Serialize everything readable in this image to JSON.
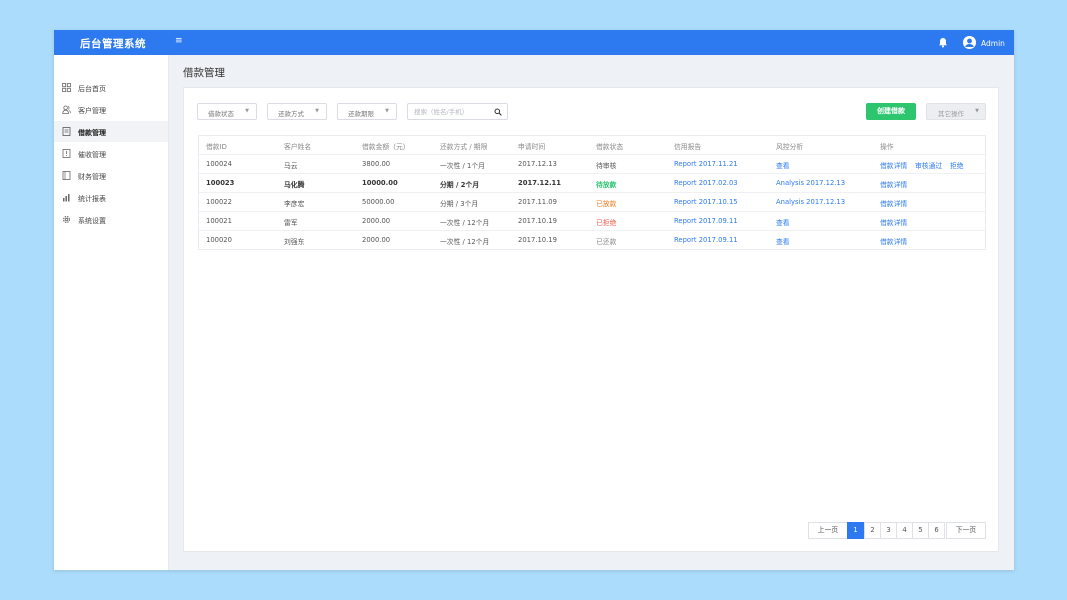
{
  "header": {
    "app_title": "后台管理系统",
    "menu_icon": "menu-icon",
    "bell_icon": "bell-icon",
    "user_name": "Admin",
    "accent_color": "#2d7af0"
  },
  "sidebar": {
    "items": [
      {
        "label": "后台首页",
        "icon": "grid-icon",
        "active": false
      },
      {
        "label": "客户管理",
        "icon": "users-icon",
        "active": false
      },
      {
        "label": "借款管理",
        "icon": "document-icon",
        "active": true
      },
      {
        "label": "催收管理",
        "icon": "flag-icon",
        "active": false
      },
      {
        "label": "财务管理",
        "icon": "book-icon",
        "active": false
      },
      {
        "label": "统计报表",
        "icon": "bar-chart-icon",
        "active": false
      },
      {
        "label": "系统设置",
        "icon": "gear-icon",
        "active": false
      }
    ]
  },
  "page": {
    "title": "借款管理"
  },
  "filters": {
    "status": "借款状态",
    "method": "还款方式",
    "term": "还款期限",
    "search_placeholder": "搜索（姓名/手机）"
  },
  "actions": {
    "create": "创建借款",
    "other": "其它操作",
    "create_color": "#2ec56f"
  },
  "table": {
    "columns": [
      "借款ID",
      "客户姓名",
      "借款金额（元）",
      "还款方式 / 期限",
      "申请时间",
      "借款状态",
      "信用报告",
      "风控分析",
      "操作"
    ],
    "rows": [
      {
        "id": "100024",
        "name": "马云",
        "amount": "3800.00",
        "method": "一次性 / 1个月",
        "date": "2017.12.13",
        "status": "待审核",
        "report": "Report  2017.11.21",
        "risk": "查看",
        "op1": "借款详情",
        "op2": "审核通过",
        "op3": "拒绝"
      },
      {
        "id": "100023",
        "name": "马化腾",
        "amount": "10000.00",
        "method": "分期 / 2个月",
        "date": "2017.12.11",
        "status": "待放款",
        "report": "Report  2017.02.03",
        "risk": "Analysis   2017.12.13",
        "op1": "借款详情",
        "op2": "",
        "op3": ""
      },
      {
        "id": "100022",
        "name": "李彦宏",
        "amount": "50000.00",
        "method": "分期 / 3个月",
        "date": "2017.11.09",
        "status": "已放款",
        "report": "Report  2017.10.15",
        "risk": "Analysis   2017.12.13",
        "op1": "借款详情",
        "op2": "",
        "op3": ""
      },
      {
        "id": "100021",
        "name": "雷军",
        "amount": "2000.00",
        "method": "一次性 / 12个月",
        "date": "2017.10.19",
        "status": "已拒绝",
        "report": "Report  2017.09.11",
        "risk": "查看",
        "op1": "借款详情",
        "op2": "",
        "op3": ""
      },
      {
        "id": "100020",
        "name": "刘强东",
        "amount": "2000.00",
        "method": "一次性 / 12个月",
        "date": "2017.10.19",
        "status": "已还款",
        "report": "Report  2017.09.11",
        "risk": "查看",
        "op1": "借款详情",
        "op2": "",
        "op3": ""
      }
    ]
  },
  "pagination": {
    "prev": "上一页",
    "pages": [
      "1",
      "2",
      "3",
      "4",
      "5",
      "6"
    ],
    "current": "1",
    "next": "下一页"
  }
}
